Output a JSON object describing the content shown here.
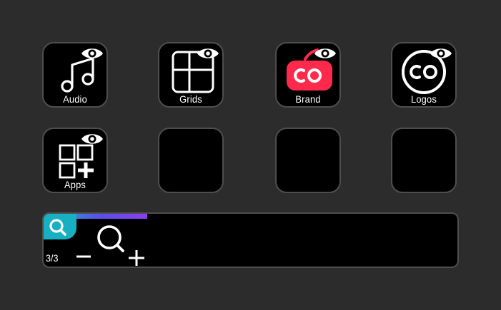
{
  "keys": [
    {
      "id": "audio",
      "label": "Audio",
      "icon": "music-note-icon",
      "visible_badge": "eye-icon"
    },
    {
      "id": "grids",
      "label": "Grids",
      "icon": "grid-icon",
      "visible_badge": "eye-icon"
    },
    {
      "id": "brand",
      "label": "Brand",
      "icon": "brand-co-icon",
      "visible_badge": "eye-icon"
    },
    {
      "id": "logos",
      "label": "Logos",
      "icon": "logo-co-icon",
      "visible_badge": "eye-icon"
    },
    {
      "id": "apps",
      "label": "Apps",
      "icon": "apps-add-icon",
      "visible_badge": "eye-icon"
    },
    {
      "id": "empty-1",
      "label": ""
    },
    {
      "id": "empty-2",
      "label": ""
    },
    {
      "id": "empty-3",
      "label": ""
    }
  ],
  "dial": {
    "page_indicator": "3/3",
    "icon": "zoom-icon",
    "tab_icon": "search-icon",
    "progress": 0.25
  },
  "colors": {
    "background": "#2c2c2c",
    "key_fill": "#000000",
    "key_border": "#4e4e4e",
    "brand_red": "#ff2a4b",
    "dial_tab": "#16b0c2",
    "progress_start": "#1fb8c4",
    "progress_end": "#8a3ff0"
  }
}
